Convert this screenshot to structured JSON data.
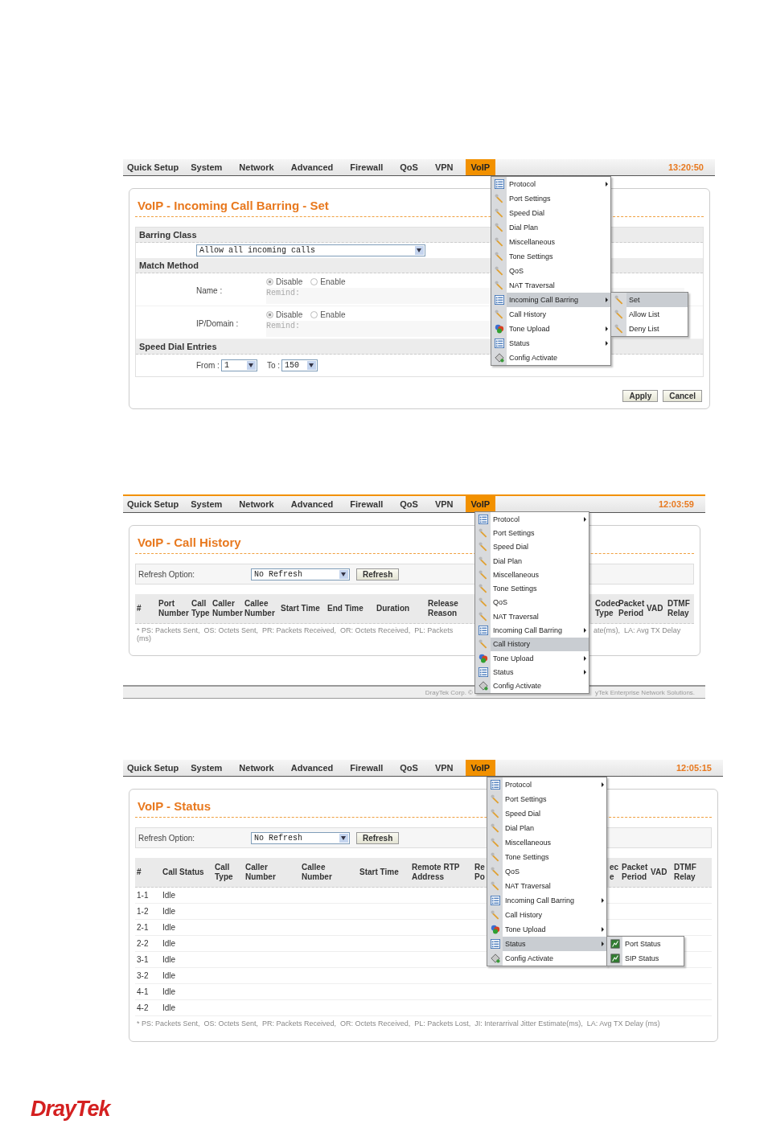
{
  "screens": [
    {
      "kind": "barring_form",
      "nav": {
        "items": [
          {
            "label": "Quick Setup",
            "selected": false
          },
          {
            "label": "System",
            "selected": false
          },
          {
            "label": "Network",
            "selected": false
          },
          {
            "label": "Advanced",
            "selected": false
          },
          {
            "label": "Firewall",
            "selected": false
          },
          {
            "label": "QoS",
            "selected": false
          },
          {
            "label": "VPN",
            "selected": false
          },
          {
            "label": "VoIP",
            "selected": true
          }
        ],
        "time": "13:20:50"
      },
      "title": "VoIP - Incoming Call Barring - Set",
      "sections": [
        {
          "kind": "select",
          "heading": "Barring Class",
          "value": "Allow all incoming calls"
        },
        {
          "kind": "match",
          "heading": "Match Method",
          "rows": [
            {
              "label": "Name :",
              "options": [
                {
                  "label": "Disable",
                  "selected": true
                },
                {
                  "label": "Enable",
                  "selected": false
                }
              ],
              "placeholder": "Remind:"
            },
            {
              "label": "IP/Domain :",
              "options": [
                {
                  "label": "Disable",
                  "selected": true
                },
                {
                  "label": "Enable",
                  "selected": false
                }
              ],
              "placeholder": "Remind:"
            }
          ]
        },
        {
          "kind": "range",
          "heading": "Speed Dial Entries",
          "from_label": "From :",
          "from_value": "1",
          "to_label": "To :",
          "to_value": "150"
        }
      ],
      "buttons": [
        "Apply",
        "Cancel"
      ],
      "menu": [
        {
          "label": "Protocol",
          "submenu": true,
          "selected": false
        },
        {
          "label": "Port Settings",
          "submenu": false,
          "selected": false
        },
        {
          "label": "Speed Dial",
          "submenu": false,
          "selected": false
        },
        {
          "label": "Dial Plan",
          "submenu": false,
          "selected": false
        },
        {
          "label": "Miscellaneous",
          "submenu": false,
          "selected": false
        },
        {
          "label": "Tone Settings",
          "submenu": false,
          "selected": false
        },
        {
          "label": "QoS",
          "submenu": false,
          "selected": false
        },
        {
          "label": "NAT Traversal",
          "submenu": false,
          "selected": false
        },
        {
          "label": "Incoming Call Barring",
          "submenu": true,
          "selected": true,
          "children": [
            {
              "label": "Set",
              "selected": true
            },
            {
              "label": "Allow List",
              "selected": false
            },
            {
              "label": "Deny List",
              "selected": false
            }
          ]
        },
        {
          "label": "Call History",
          "submenu": false,
          "selected": false
        },
        {
          "label": "Tone Upload",
          "submenu": true,
          "selected": false
        },
        {
          "label": "Status",
          "submenu": true,
          "selected": false
        },
        {
          "label": "Config Activate",
          "submenu": false,
          "selected": false
        }
      ]
    },
    {
      "kind": "call_history",
      "nav": {
        "items": [
          {
            "label": "Quick Setup",
            "selected": false
          },
          {
            "label": "System",
            "selected": false
          },
          {
            "label": "Network",
            "selected": false
          },
          {
            "label": "Advanced",
            "selected": false
          },
          {
            "label": "Firewall",
            "selected": false
          },
          {
            "label": "QoS",
            "selected": false
          },
          {
            "label": "VPN",
            "selected": false
          },
          {
            "label": "VoIP",
            "selected": true
          }
        ],
        "time": "12:03:59"
      },
      "title": "VoIP - Call History",
      "refresh": {
        "label": "Refresh Option:",
        "value": "No Refresh",
        "button": "Refresh"
      },
      "columns": [
        "#",
        "Port Number",
        "Call Type",
        "Caller Number",
        "Callee Number",
        "Start Time",
        "End Time",
        "Duration",
        "Release Reason",
        "Codec Type",
        "Packet Period",
        "VAD",
        "DTMF Relay"
      ],
      "footnote_left": "* PS: Packets Sent,  OS: Octets Sent,  PR: Packets Received,  OR: Octets Received,  PL: Packets",
      "footnote_right": "ate(ms),  LA: Avg TX Delay",
      "footnote_tail": "(ms)",
      "footer_left": "DrayTek Corp. ©",
      "footer_right": "yTek Enterprise Network Solutions.",
      "menu": [
        {
          "label": "Protocol",
          "submenu": true,
          "selected": false
        },
        {
          "label": "Port Settings",
          "submenu": false,
          "selected": false
        },
        {
          "label": "Speed Dial",
          "submenu": false,
          "selected": false
        },
        {
          "label": "Dial Plan",
          "submenu": false,
          "selected": false
        },
        {
          "label": "Miscellaneous",
          "submenu": false,
          "selected": false
        },
        {
          "label": "Tone Settings",
          "submenu": false,
          "selected": false
        },
        {
          "label": "QoS",
          "submenu": false,
          "selected": false
        },
        {
          "label": "NAT Traversal",
          "submenu": false,
          "selected": false
        },
        {
          "label": "Incoming Call Barring",
          "submenu": true,
          "selected": false
        },
        {
          "label": "Call History",
          "submenu": false,
          "selected": true
        },
        {
          "label": "Tone Upload",
          "submenu": true,
          "selected": false
        },
        {
          "label": "Status",
          "submenu": true,
          "selected": false
        },
        {
          "label": "Config Activate",
          "submenu": false,
          "selected": false
        }
      ]
    },
    {
      "kind": "status",
      "nav": {
        "items": [
          {
            "label": "Quick Setup",
            "selected": false
          },
          {
            "label": "System",
            "selected": false
          },
          {
            "label": "Network",
            "selected": false
          },
          {
            "label": "Advanced",
            "selected": false
          },
          {
            "label": "Firewall",
            "selected": false
          },
          {
            "label": "QoS",
            "selected": false
          },
          {
            "label": "VPN",
            "selected": false
          },
          {
            "label": "VoIP",
            "selected": true
          }
        ],
        "time": "12:05:15"
      },
      "title": "VoIP - Status",
      "refresh": {
        "label": "Refresh Option:",
        "value": "No Refresh",
        "button": "Refresh"
      },
      "columns": [
        "#",
        "Call Status",
        "Call Type",
        "Caller Number",
        "Callee Number",
        "Start Time",
        "Remote RTP Address",
        "Re Po",
        "ec e",
        "Packet Period",
        "VAD",
        "DTMF Relay"
      ],
      "rows": [
        {
          "port": "1-1",
          "status": "Idle"
        },
        {
          "port": "1-2",
          "status": "Idle"
        },
        {
          "port": "2-1",
          "status": "Idle"
        },
        {
          "port": "2-2",
          "status": "Idle"
        },
        {
          "port": "3-1",
          "status": "Idle"
        },
        {
          "port": "3-2",
          "status": "Idle"
        },
        {
          "port": "4-1",
          "status": "Idle"
        },
        {
          "port": "4-2",
          "status": "Idle"
        }
      ],
      "footnote": "* PS: Packets Sent,  OS: Octets Sent,  PR: Packets Received,  OR: Octets Received,  PL: Packets Lost,  JI: Interarrival Jitter Estimate(ms),  LA: Avg TX Delay (ms)",
      "menu": [
        {
          "label": "Protocol",
          "submenu": true,
          "selected": false
        },
        {
          "label": "Port Settings",
          "submenu": false,
          "selected": false
        },
        {
          "label": "Speed Dial",
          "submenu": false,
          "selected": false
        },
        {
          "label": "Dial Plan",
          "submenu": false,
          "selected": false
        },
        {
          "label": "Miscellaneous",
          "submenu": false,
          "selected": false
        },
        {
          "label": "Tone Settings",
          "submenu": false,
          "selected": false
        },
        {
          "label": "QoS",
          "submenu": false,
          "selected": false
        },
        {
          "label": "NAT Traversal",
          "submenu": false,
          "selected": false
        },
        {
          "label": "Incoming Call Barring",
          "submenu": true,
          "selected": false
        },
        {
          "label": "Call History",
          "submenu": false,
          "selected": false
        },
        {
          "label": "Tone Upload",
          "submenu": true,
          "selected": false
        },
        {
          "label": "Status",
          "submenu": true,
          "selected": true,
          "children": [
            {
              "label": "Port Status",
              "selected": false
            },
            {
              "label": "SIP Status",
              "selected": false
            }
          ]
        },
        {
          "label": "Config Activate",
          "submenu": false,
          "selected": false
        }
      ]
    }
  ],
  "logo": "DrayTek"
}
